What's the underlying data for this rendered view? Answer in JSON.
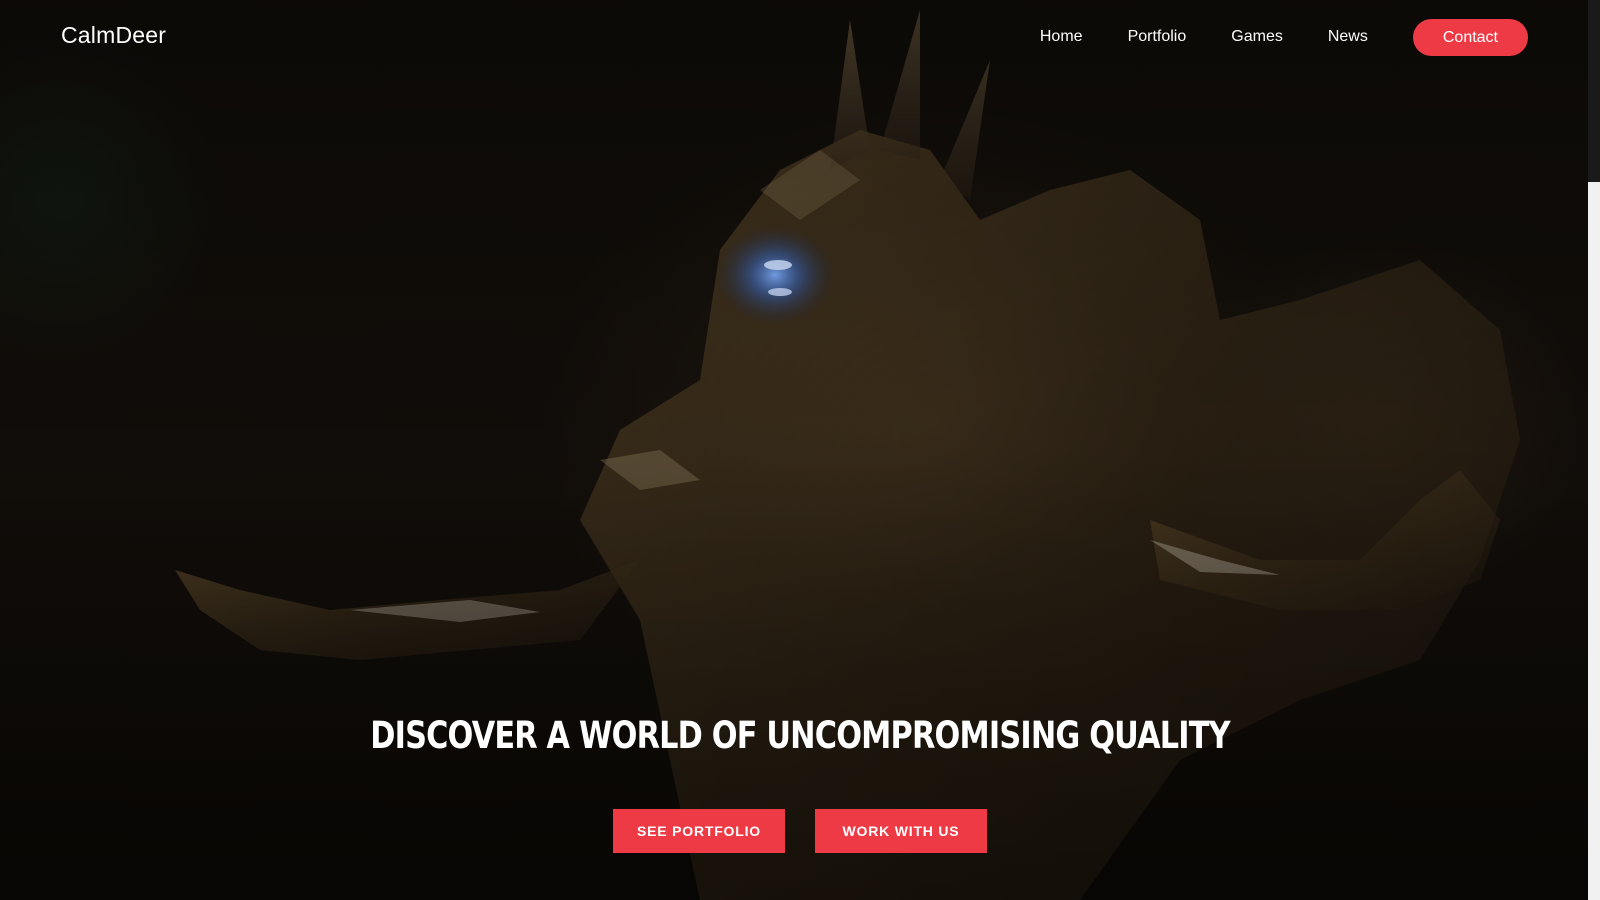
{
  "header": {
    "brand": "CalmDeer",
    "nav": {
      "home": "Home",
      "portfolio": "Portfolio",
      "games": "Games",
      "news": "News",
      "contact": "Contact"
    }
  },
  "hero": {
    "title": "DISCOVER A WORLD OF UNCOMPROMISING QUALITY",
    "buttons": {
      "see_portfolio": "SEE PORTFOLIO",
      "work_with_us": "WORK WITH US"
    }
  },
  "colors": {
    "accent": "#ee3a45",
    "background": "#0d0a07",
    "text": "#ffffff",
    "glow": "#4a7bd6"
  }
}
